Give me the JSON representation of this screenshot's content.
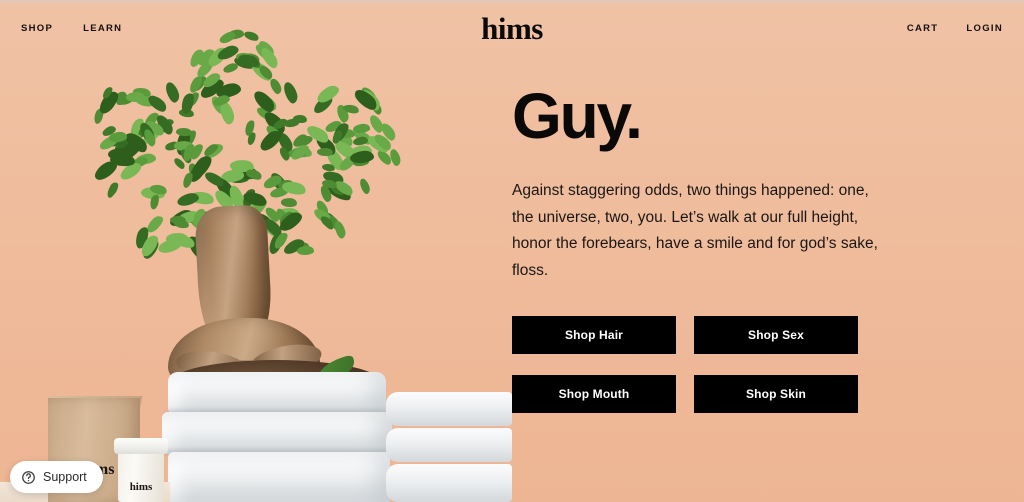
{
  "header": {
    "logo": "hims",
    "nav_left": [
      {
        "label": "SHOP",
        "name": "nav-link-shop"
      },
      {
        "label": "LEARN",
        "name": "nav-link-learn"
      }
    ],
    "nav_right": [
      {
        "label": "CART",
        "name": "nav-link-cart"
      },
      {
        "label": "LOGIN",
        "name": "nav-link-login"
      }
    ]
  },
  "hero": {
    "headline": "Guy.",
    "subhead": "Against staggering odds, two things happened: one, the universe, two, you. Let’s walk at our full height, honor the forebears, have a smile and for god’s sake, floss.",
    "cta_buttons": [
      {
        "label": "Shop Hair",
        "name": "cta-shop-hair"
      },
      {
        "label": "Shop Sex",
        "name": "cta-shop-sex"
      },
      {
        "label": "Shop Mouth",
        "name": "cta-shop-mouth"
      },
      {
        "label": "Shop Skin",
        "name": "cta-shop-skin"
      }
    ]
  },
  "photo": {
    "description": "Bonsai ficus tree in a stacked white ceramic pot with a kraft shipping box and hims pill bottle",
    "kraft_box_label": "hims",
    "bottle_label": "hims"
  },
  "support": {
    "label": "Support",
    "icon": "question-circle-icon"
  },
  "colors": {
    "background_peach": "#EFBC9D",
    "cta_black": "#000000",
    "text_dark": "#0B0907",
    "support_white": "#FFFFFF"
  }
}
